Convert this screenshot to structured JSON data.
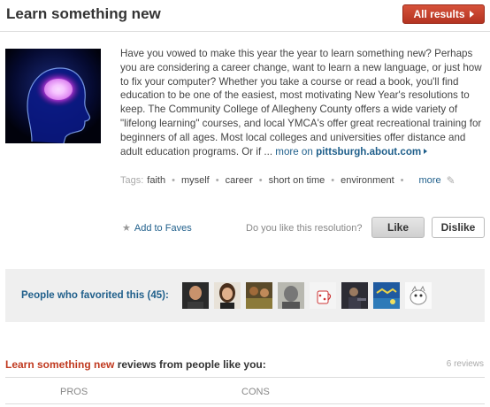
{
  "header": {
    "title": "Learn something new",
    "all_results_label": "All results"
  },
  "description": {
    "text": "Have you vowed to make this year the year to learn something new? Perhaps you are considering a career change, want to learn a new language, or just how to fix your computer? Whether you take a course or read a book, you'll find education to be one of the easiest, most motivating New Year's resolutions to keep. The Community College of Allegheny County offers a wide variety of \"lifelong learning\" courses, and local YMCA's offer great recreational training for beginners of all ages. Most local colleges and universities offer distance and adult education programs. Or if ...",
    "more_on": "more on",
    "source": "pittsburgh.about.com"
  },
  "tags": {
    "label": "Tags:",
    "items": [
      "faith",
      "myself",
      "career",
      "short on time",
      "environment"
    ],
    "more_label": "more"
  },
  "actions": {
    "add_to_faves": "Add to Faves",
    "question": "Do you like this resolution?",
    "like": "Like",
    "dislike": "Dislike"
  },
  "favorites": {
    "label": "People who favorited this (45):",
    "avatars": [
      "avatar-1",
      "avatar-2",
      "avatar-3",
      "avatar-4",
      "avatar-5",
      "avatar-6",
      "avatar-7",
      "avatar-8"
    ]
  },
  "reviews": {
    "heading_highlight": "Learn something new",
    "heading_rest": " reviews from people like you:",
    "count": "6 reviews",
    "pros_label": "PROS",
    "cons_label": "CONS"
  },
  "colors": {
    "accent_red": "#c0391f",
    "link_blue": "#1f5f8b"
  }
}
